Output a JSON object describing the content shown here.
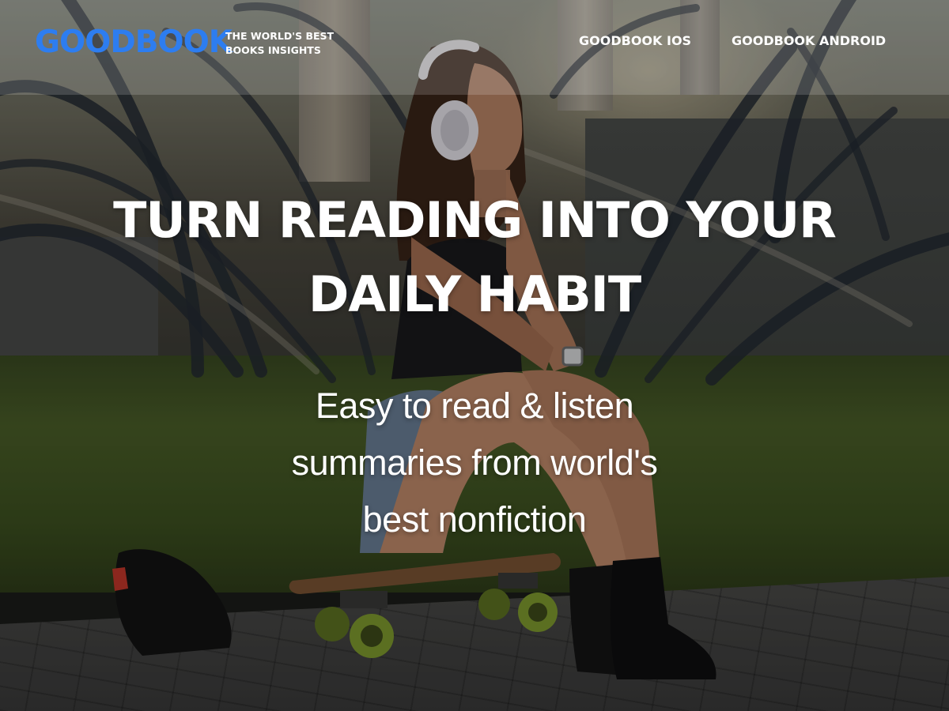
{
  "header": {
    "logo": "GOODBOOK",
    "tagline_line1": "THE WORLD'S BEST",
    "tagline_line2": "BOOKS INSIGHTS",
    "nav": [
      {
        "label": "GOODBOOK IOS"
      },
      {
        "label": "GOODBOOK ANDROID"
      }
    ]
  },
  "hero": {
    "title_line1": "TURN READING INTO YOUR",
    "title_line2": "DAILY HABIT",
    "subtitle_line1": "Easy to read & listen",
    "subtitle_line2": "summaries from world's",
    "subtitle_line3": "best nonfiction"
  },
  "colors": {
    "brand": "#2d7df0",
    "text": "#ffffff",
    "header_overlay": "rgba(255,255,255,0.16)"
  },
  "icons": {
    "background": "hero-photo-girl-with-headphones-on-skateboard"
  }
}
